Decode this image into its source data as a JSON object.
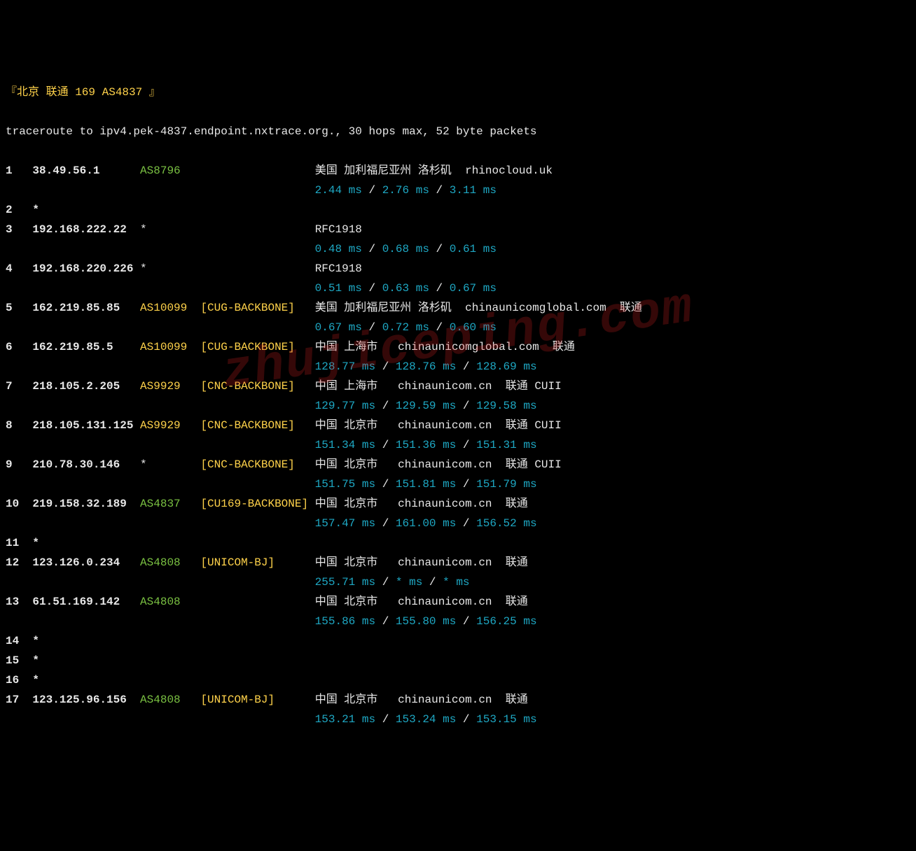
{
  "header": "『北京 联通 169 AS4837 』",
  "cmd": "traceroute to ipv4.pek-4837.endpoint.nxtrace.org., 30 hops max, 52 byte packets",
  "watermark": "zhujiceping.com",
  "hops": [
    {
      "n": "1",
      "ip": "38.49.56.1",
      "asn": "AS8796",
      "asn_color": "green",
      "tag": "",
      "geo": "美国 加利福尼亚州 洛杉矶  rhinocloud.uk",
      "lat": "2.44 ms / 2.76 ms / 3.11 ms"
    },
    {
      "n": "2",
      "ip": "*",
      "asn": "",
      "asn_color": "",
      "tag": "",
      "geo": "",
      "lat": ""
    },
    {
      "n": "3",
      "ip": "192.168.222.22",
      "asn": "*",
      "asn_color": "white",
      "tag": "",
      "geo": "RFC1918",
      "lat": "0.48 ms / 0.68 ms / 0.61 ms"
    },
    {
      "n": "4",
      "ip": "192.168.220.226",
      "asn": "*",
      "asn_color": "white",
      "tag": "",
      "geo": "RFC1918",
      "lat": "0.51 ms / 0.63 ms / 0.67 ms"
    },
    {
      "n": "5",
      "ip": "162.219.85.85",
      "asn": "AS10099",
      "asn_color": "yellow",
      "tag": "[CUG-BACKBONE]",
      "geo": "美国 加利福尼亚州 洛杉矶  chinaunicomglobal.com  联通",
      "lat": "0.67 ms / 0.72 ms / 0.60 ms"
    },
    {
      "n": "6",
      "ip": "162.219.85.5",
      "asn": "AS10099",
      "asn_color": "yellow",
      "tag": "[CUG-BACKBONE]",
      "geo": "中国 上海市   chinaunicomglobal.com  联通",
      "lat": "128.77 ms / 128.76 ms / 128.69 ms"
    },
    {
      "n": "7",
      "ip": "218.105.2.205",
      "asn": "AS9929",
      "asn_color": "yellow",
      "tag": "[CNC-BACKBONE]",
      "geo": "中国 上海市   chinaunicom.cn  联通 CUII",
      "lat": "129.77 ms / 129.59 ms / 129.58 ms"
    },
    {
      "n": "8",
      "ip": "218.105.131.125",
      "asn": "AS9929",
      "asn_color": "yellow",
      "tag": "[CNC-BACKBONE]",
      "geo": "中国 北京市   chinaunicom.cn  联通 CUII",
      "lat": "151.34 ms / 151.36 ms / 151.31 ms"
    },
    {
      "n": "9",
      "ip": "210.78.30.146",
      "asn": "*",
      "asn_color": "white",
      "tag": "[CNC-BACKBONE]",
      "geo": "中国 北京市   chinaunicom.cn  联通 CUII",
      "lat": "151.75 ms / 151.81 ms / 151.79 ms"
    },
    {
      "n": "10",
      "ip": "219.158.32.189",
      "asn": "AS4837",
      "asn_color": "green",
      "tag": "[CU169-BACKBONE]",
      "geo": "中国 北京市   chinaunicom.cn  联通",
      "lat": "157.47 ms / 161.00 ms / 156.52 ms"
    },
    {
      "n": "11",
      "ip": "*",
      "asn": "",
      "asn_color": "",
      "tag": "",
      "geo": "",
      "lat": ""
    },
    {
      "n": "12",
      "ip": "123.126.0.234",
      "asn": "AS4808",
      "asn_color": "green",
      "tag": "[UNICOM-BJ]",
      "geo": "中国 北京市   chinaunicom.cn  联通",
      "lat": "255.71 ms / * ms / * ms"
    },
    {
      "n": "13",
      "ip": "61.51.169.142",
      "asn": "AS4808",
      "asn_color": "green",
      "tag": "",
      "geo": "中国 北京市   chinaunicom.cn  联通",
      "lat": "155.86 ms / 155.80 ms / 156.25 ms"
    },
    {
      "n": "14",
      "ip": "*",
      "asn": "",
      "asn_color": "",
      "tag": "",
      "geo": "",
      "lat": ""
    },
    {
      "n": "15",
      "ip": "*",
      "asn": "",
      "asn_color": "",
      "tag": "",
      "geo": "",
      "lat": ""
    },
    {
      "n": "16",
      "ip": "*",
      "asn": "",
      "asn_color": "",
      "tag": "",
      "geo": "",
      "lat": ""
    },
    {
      "n": "17",
      "ip": "123.125.96.156",
      "asn": "AS4808",
      "asn_color": "green",
      "tag": "[UNICOM-BJ]",
      "geo": "中国 北京市   chinaunicom.cn  联通",
      "lat": "153.21 ms / 153.24 ms / 153.15 ms"
    }
  ]
}
